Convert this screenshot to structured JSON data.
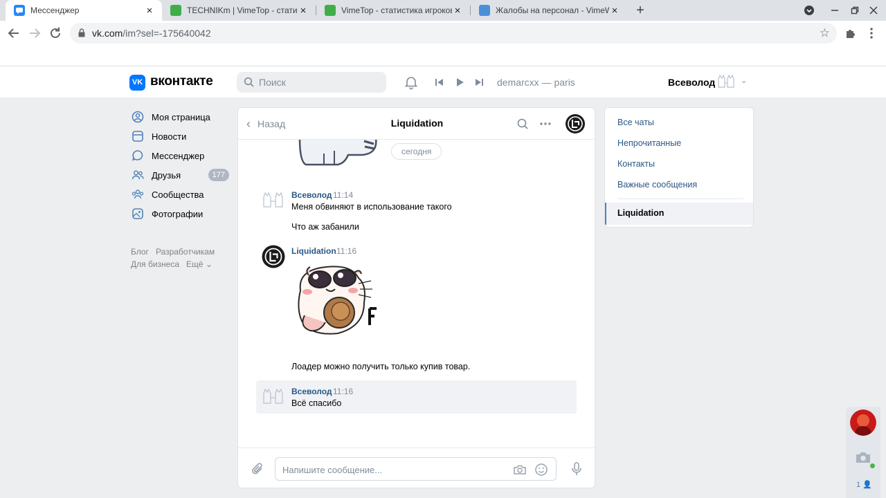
{
  "browser": {
    "tabs": [
      {
        "title": "Мессенджер",
        "active": true
      },
      {
        "title": "TECHNIKm | VimeTop - статистика"
      },
      {
        "title": "VimeTop - статистика игроков VimeWorld"
      },
      {
        "title": "Жалобы на персонал - VimeWorld"
      }
    ],
    "url_host": "vk.com",
    "url_path": "/im?sel=-175640042"
  },
  "header": {
    "logo_mark": "VK",
    "logo_text": "вконтакте",
    "search_placeholder": "Поиск",
    "now_playing": "demarcxx — paris",
    "user_name": "Всеволод"
  },
  "left_menu": {
    "items": [
      {
        "label": "Моя страница",
        "icon": "user-circle-icon"
      },
      {
        "label": "Новости",
        "icon": "news-icon"
      },
      {
        "label": "Мессенджер",
        "icon": "message-icon"
      },
      {
        "label": "Друзья",
        "icon": "friends-icon",
        "badge": "177"
      },
      {
        "label": "Сообщества",
        "icon": "communities-icon"
      },
      {
        "label": "Фотографии",
        "icon": "photos-icon"
      }
    ],
    "footer_links": [
      "Блог",
      "Разработчикам",
      "Для бизнеса",
      "Ещё ⌄"
    ]
  },
  "chat": {
    "back_label": "Назад",
    "title": "Liquidation",
    "date_divider": "сегодня",
    "messages": [
      {
        "author": "Всеволод",
        "time": "11:14",
        "lines": [
          "Меня обвиняют в использование такого",
          "Что аж забанили"
        ]
      },
      {
        "author": "Liquidation",
        "time": "11:16",
        "lines": [
          "Лоадер можно получить только купив товар."
        ]
      },
      {
        "author": "Всеволод",
        "time": "11:16",
        "lines": [
          "Всё спасибо"
        ]
      }
    ],
    "input_placeholder": "Напишите сообщение..."
  },
  "right_panel": {
    "items": [
      "Все чаты",
      "Непрочитанные",
      "Контакты",
      "Важные сообщения"
    ],
    "active_chat": "Liquidation"
  },
  "float_widget": {
    "count": "1"
  },
  "colors": {
    "vk_blue": "#0077ff",
    "link": "#2a5885",
    "muted": "#818c99",
    "page_bg": "#edeef0",
    "badge": "#aeb7c2",
    "online": "#4bb34b"
  }
}
